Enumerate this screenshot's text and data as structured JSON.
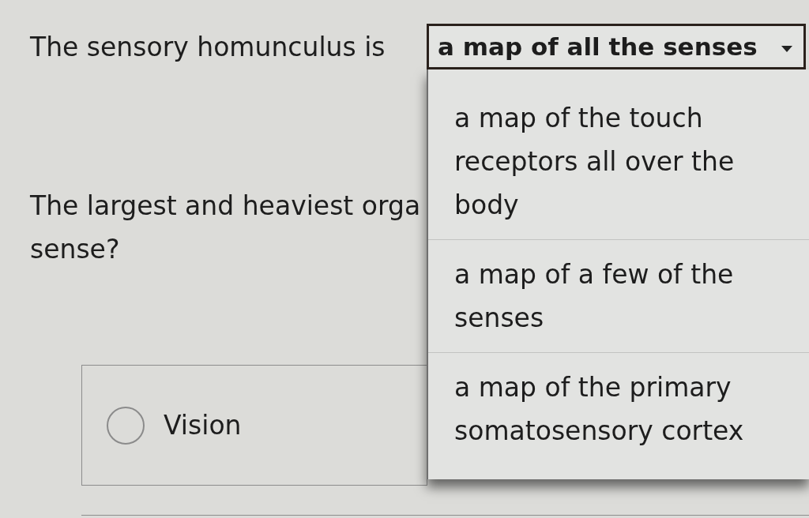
{
  "questions": [
    {
      "kind": "dropdown",
      "text_lines": [
        "The sensory homunculus is"
      ],
      "dropdown": {
        "value": "a map of all the senses",
        "expanded": true,
        "options": [
          {
            "label": "a map of the touch receptors all over the body",
            "selected": false
          },
          {
            "label": "a map of a few of the senses",
            "selected": false
          },
          {
            "label": "a map of the primary somatosensory cortex",
            "selected": false
          }
        ]
      }
    },
    {
      "kind": "choice",
      "text_lines": [
        "The largest and heaviest orga",
        "sense?"
      ],
      "choices": [
        {
          "label": "Vision",
          "selected": false
        }
      ]
    }
  ]
}
